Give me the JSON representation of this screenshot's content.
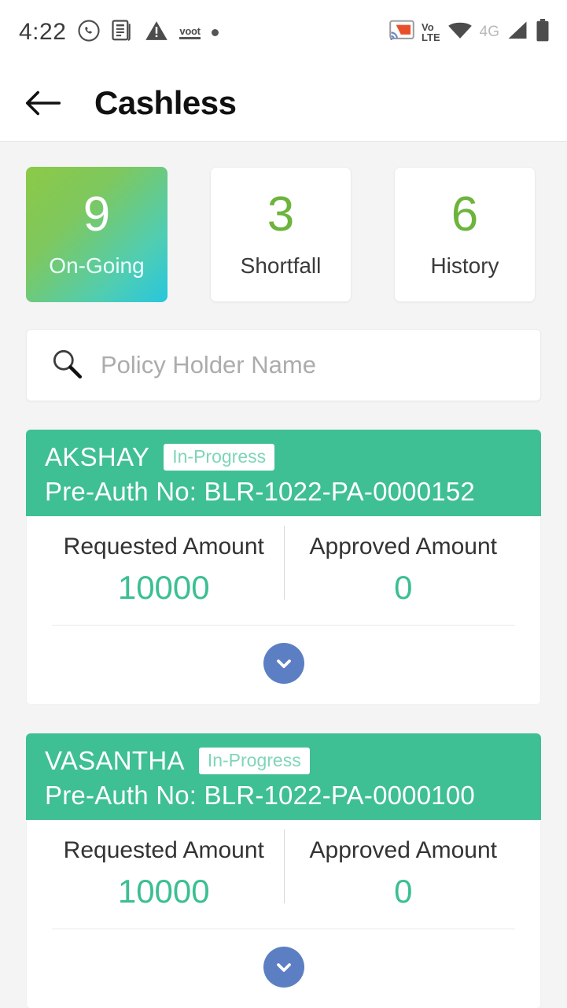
{
  "status_bar": {
    "time": "4:22",
    "left_icons": [
      {
        "name": "whatsapp-icon"
      },
      {
        "name": "news-document-icon"
      },
      {
        "name": "warning-triangle-icon"
      },
      {
        "name": "voot-app-icon",
        "label": "voot"
      },
      {
        "name": "generic-notification-dot-icon"
      }
    ],
    "right_icons": [
      {
        "name": "screen-cast-icon"
      },
      {
        "name": "volte-icon",
        "line1": "Vo",
        "line2": "LTE"
      },
      {
        "name": "wifi-icon"
      },
      {
        "name": "network-type-label",
        "label": "4G"
      },
      {
        "name": "cellular-signal-icon"
      },
      {
        "name": "battery-icon"
      }
    ]
  },
  "app_bar": {
    "back_label": "Back",
    "title": "Cashless"
  },
  "tabs": [
    {
      "count": "9",
      "label": "On-Going",
      "active": true
    },
    {
      "count": "3",
      "label": "Shortfall",
      "active": false
    },
    {
      "count": "6",
      "label": "History",
      "active": false
    }
  ],
  "search": {
    "placeholder": "Policy Holder Name",
    "value": ""
  },
  "claims": [
    {
      "name": "AKSHAY",
      "status": "In-Progress",
      "preauth": "Pre-Auth No: BLR-1022-PA-0000152",
      "requested_label": "Requested Amount",
      "requested_value": "10000",
      "approved_label": "Approved Amount",
      "approved_value": "0"
    },
    {
      "name": "VASANTHA",
      "status": "In-Progress",
      "preauth": "Pre-Auth No: BLR-1022-PA-0000100",
      "requested_label": "Requested Amount",
      "requested_value": "10000",
      "approved_label": "Approved Amount",
      "approved_value": "0"
    }
  ],
  "colors": {
    "header_green": "#3fbf94",
    "amount_green": "#3cbf92",
    "tab_number_green": "#6cb43c",
    "expand_blue": "#5c7fc4",
    "page_bg": "#f4f4f4"
  }
}
